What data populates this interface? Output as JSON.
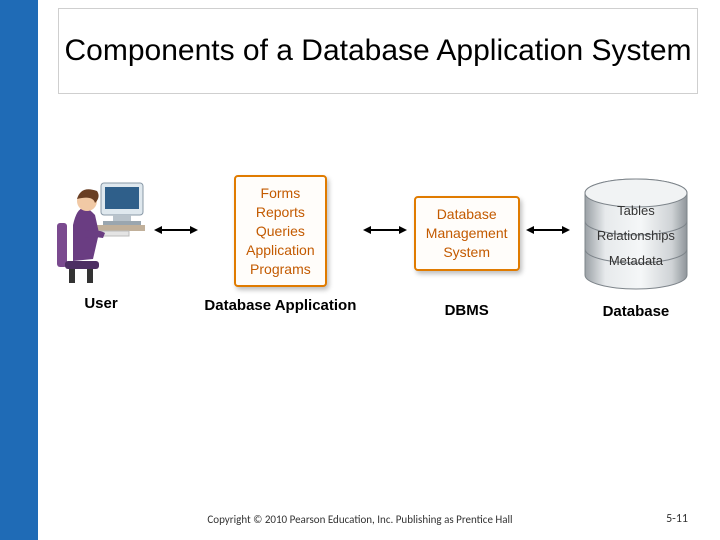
{
  "title": "Components of a Database Application System",
  "components": {
    "user": {
      "label": "User"
    },
    "app": {
      "label": "Database Application",
      "lines": [
        "Forms",
        "Reports",
        "Queries",
        "Application",
        "Programs"
      ]
    },
    "dbms": {
      "label": "DBMS",
      "lines": [
        "Database",
        "Management",
        "System"
      ]
    },
    "database": {
      "label": "Database",
      "lines": [
        "Tables",
        "Relationships",
        "Metadata"
      ]
    }
  },
  "footer": {
    "copyright": "Copyright © 2010 Pearson Education, Inc. Publishing as Prentice Hall",
    "page": "5-11"
  }
}
